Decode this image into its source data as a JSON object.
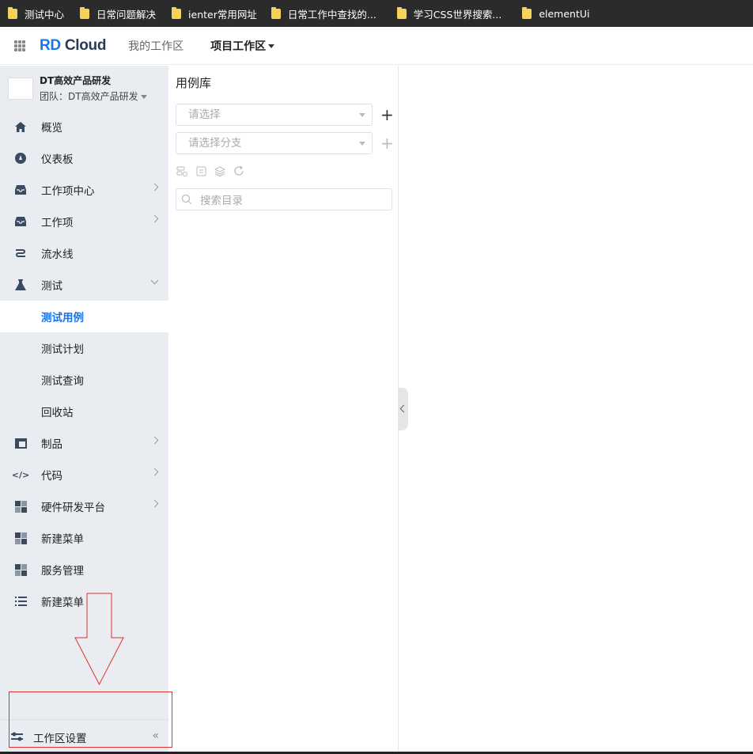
{
  "bookmarks": [
    "测试中心",
    "日常问题解决",
    "ienter常用网址",
    "日常工作中查找的...",
    "学习CSS世界搜索...",
    "elementUi"
  ],
  "header": {
    "logo_rd": "RD",
    "logo_cloud": "Cloud",
    "nav": [
      "我的工作区",
      "项目工作区"
    ]
  },
  "team": {
    "name": "DT高效产品研发",
    "sub": "团队：DT高效产品研发"
  },
  "menu": [
    {
      "label": "概览",
      "icon": "home-icon"
    },
    {
      "label": "仪表板",
      "icon": "dashboard-icon"
    },
    {
      "label": "工作项中心",
      "icon": "inbox-icon"
    },
    {
      "label": "工作项",
      "icon": "inbox-icon"
    },
    {
      "label": "流水线",
      "icon": "pipeline-icon"
    },
    {
      "label": "测试",
      "icon": "flask-icon"
    }
  ],
  "test_sub": [
    "测试用例",
    "测试计划",
    "测试查询",
    "回收站"
  ],
  "menu2": [
    {
      "label": "制品",
      "icon": "artifact-icon"
    },
    {
      "label": "代码",
      "icon": "code-icon"
    },
    {
      "label": "硬件研发平台",
      "icon": "grid-icon"
    },
    {
      "label": "新建菜单",
      "icon": "grid-icon"
    },
    {
      "label": "服务管理",
      "icon": "grid-icon"
    },
    {
      "label": "新建菜单",
      "icon": "list-icon"
    }
  ],
  "footer": {
    "label": "工作区设置",
    "collapse": "«"
  },
  "panel": {
    "title": "用例库",
    "select1_placeholder": "请选择",
    "select2_placeholder": "请选择分支",
    "search_placeholder": "搜索目录"
  }
}
